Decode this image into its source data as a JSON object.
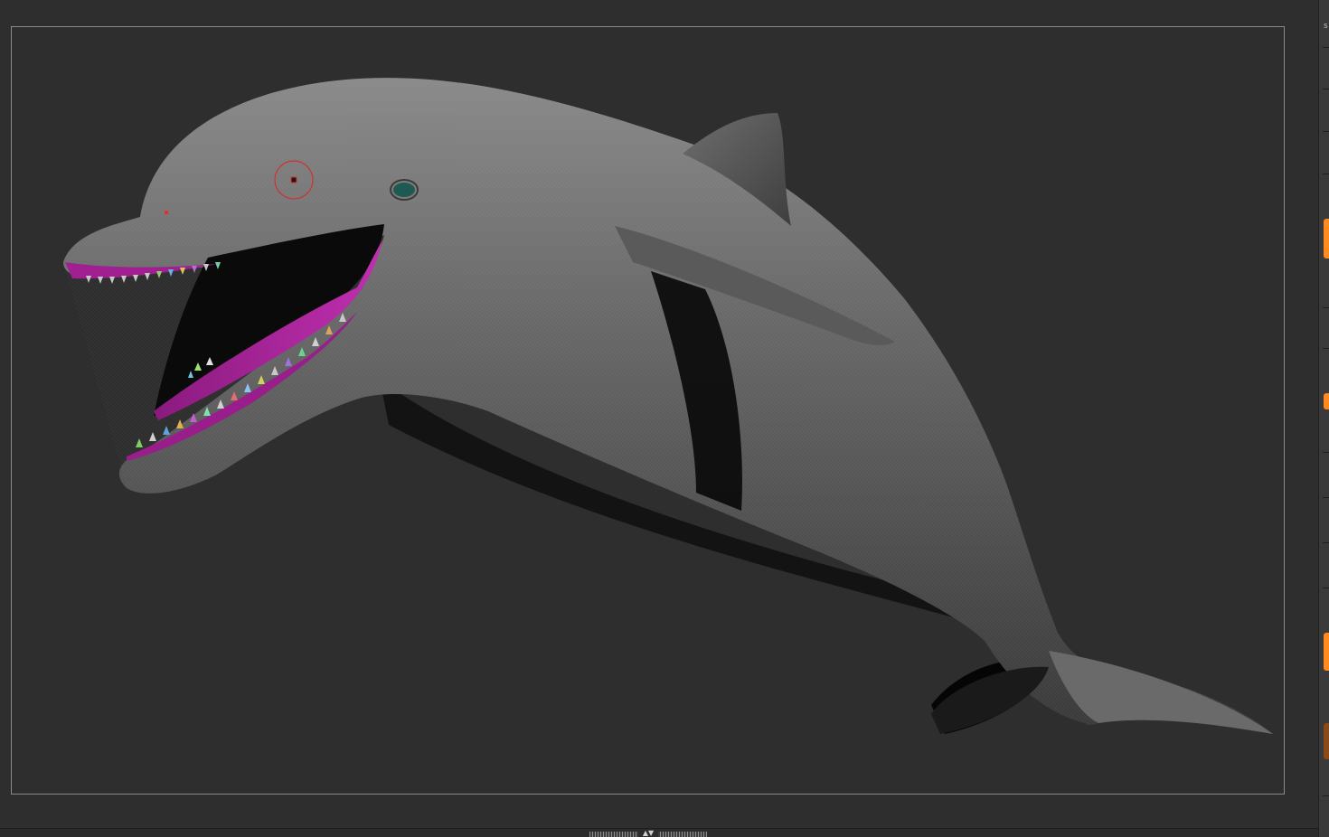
{
  "viewport": {
    "background": "#2e2e2e",
    "frame_color": "#8a8a8a",
    "model_name": "dolphin-mesh"
  },
  "model": {
    "skin_color": "#6f6f6f",
    "mouth_color": "#b0209c",
    "eye_color": "#1f5a52",
    "brush_cursor_color": "#e03030"
  },
  "right_strip": {
    "letter": "s",
    "accent_color": "#ff8a1e",
    "muted_accent_color": "#8a4a18"
  },
  "bottom_bar": {
    "splitter_icon": "double-arrow-icon",
    "arrows": "▲▼"
  }
}
